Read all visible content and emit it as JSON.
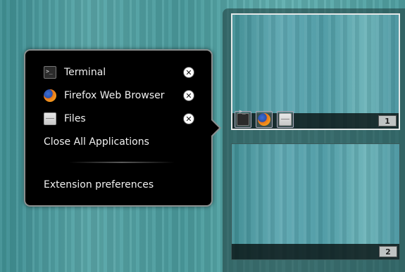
{
  "menu": {
    "apps": [
      {
        "label": "Terminal",
        "icon": "terminal-icon"
      },
      {
        "label": "Firefox Web Browser",
        "icon": "firefox-icon"
      },
      {
        "label": "Files",
        "icon": "files-icon"
      }
    ],
    "close_all_label": "Close All Applications",
    "preferences_label": "Extension preferences"
  },
  "workspaces": [
    {
      "number": "1",
      "active": true,
      "apps": [
        "terminal-icon",
        "firefox-icon",
        "files-icon"
      ]
    },
    {
      "number": "2",
      "active": false,
      "apps": []
    }
  ]
}
